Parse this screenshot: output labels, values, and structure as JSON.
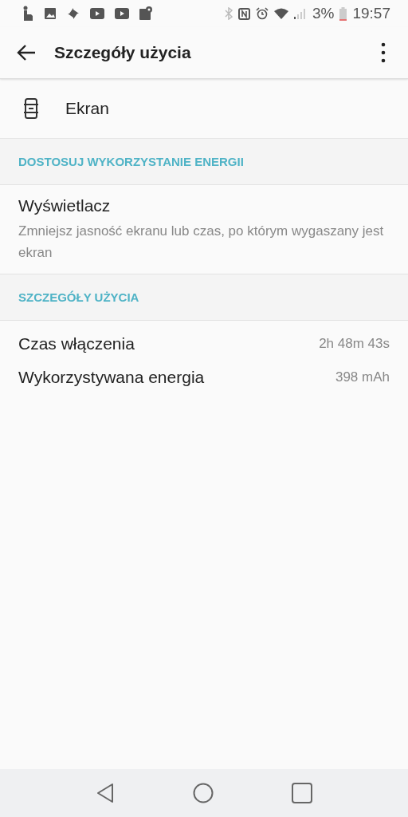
{
  "status_bar": {
    "battery": "3%",
    "time": "19:57"
  },
  "app_bar": {
    "title": "Szczegóły użycia"
  },
  "app": {
    "name": "Ekran"
  },
  "sections": [
    {
      "header": "DOSTOSUJ WYKORZYSTANIE ENERGII",
      "items": [
        {
          "kind": "setting",
          "title": "Wyświetlacz",
          "summary": "Zmniejsz jasność ekranu lub czas, po którym wygaszany jest ekran"
        }
      ]
    },
    {
      "header": "SZCZEGÓŁY UŻYCIA",
      "items": [
        {
          "kind": "stat",
          "title": "Czas włączenia",
          "value": "2h 48m 43s"
        },
        {
          "kind": "stat",
          "title": "Wykorzystywana energia",
          "value": "398 mAh"
        }
      ]
    }
  ]
}
